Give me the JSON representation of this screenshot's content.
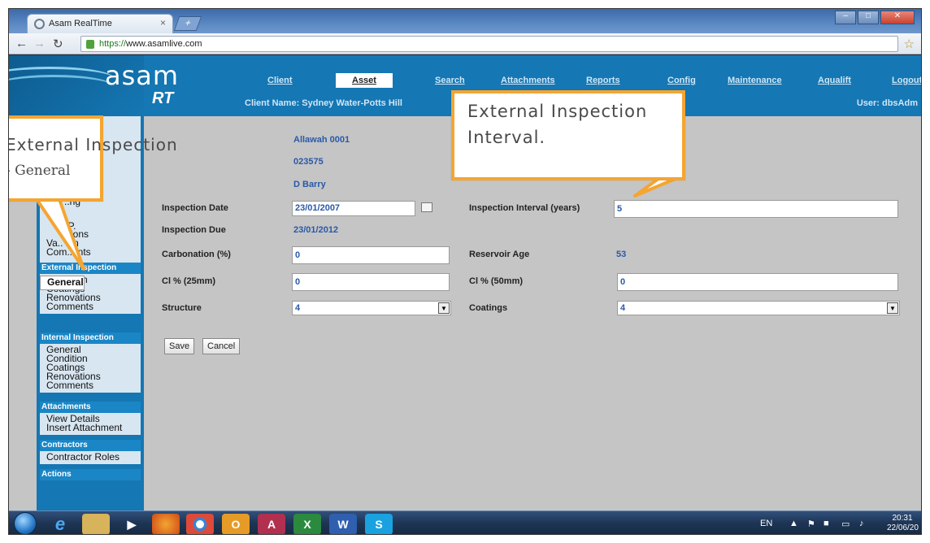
{
  "browser": {
    "tab_title": "Asam RealTime",
    "tab_close": "×",
    "new_tab": "+",
    "url_scheme": "https://",
    "url_host": "www.asamlive.com"
  },
  "app": {
    "logo_main": "asam",
    "logo_sub": "RT",
    "nav": [
      "Client",
      "Asset",
      "Search",
      "Attachments",
      "Reports",
      "Config",
      "Maintenance",
      "Aqualift",
      "Logout"
    ],
    "client_name": "Client Name: Sydney Water-Potts Hill",
    "user": "User: dbsAdm"
  },
  "sidebar": {
    "partial_items": [
      "..ng",
      "..P.",
      "..tions",
      "Va.. ion",
      "Com..ents"
    ],
    "external": {
      "title": "External Inspection",
      "items": [
        "General",
        "Condition",
        "Coatings",
        "Renovations",
        "Comments"
      ]
    },
    "internal": {
      "title": "Internal Inspection",
      "items": [
        "General",
        "Condition",
        "Coatings",
        "Renovations",
        "Comments"
      ]
    },
    "attachments": {
      "title": "Attachments",
      "items": [
        "View Details",
        "Insert Attachment"
      ]
    },
    "contractors": {
      "title": "Contractors",
      "items": [
        "Contractor Roles"
      ]
    },
    "actions": {
      "title": "Actions"
    }
  },
  "form": {
    "asset_name": "Allawah 0001",
    "asset_number": "023575",
    "inspector": "D Barry",
    "inspection_date_label": "Inspection Date",
    "inspection_date": "23/01/2007",
    "inspection_due_label": "Inspection Due",
    "inspection_due": "23/01/2012",
    "carbonation_label": "Carbonation (%)",
    "carbonation": "0",
    "cl25_label": "Cl % (25mm)",
    "cl25": "0",
    "structure_label": "Structure",
    "structure": "4",
    "interval_label": "Inspection Interval (years)",
    "interval": "5",
    "reservoir_age_label": "Reservoir Age",
    "reservoir_age": "53",
    "cl50_label": "Cl % (50mm)",
    "cl50": "0",
    "coatings_label": "Coatings",
    "coatings": "4",
    "save": "Save",
    "cancel": "Cancel"
  },
  "callouts": {
    "left_line1": "External Inspection",
    "left_line2": "- General",
    "right_line1": "External Inspection",
    "right_line2": "Interval."
  },
  "taskbar": {
    "lang": "EN",
    "time": "20:31",
    "date": "22/06/20"
  },
  "colors": {
    "accent_blue": "#1577b3",
    "callout_border": "#f4a532",
    "value_text": "#2a59a8"
  }
}
